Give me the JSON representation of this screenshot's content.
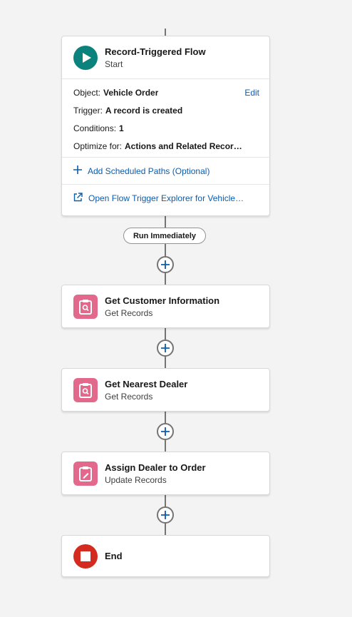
{
  "start": {
    "title": "Record-Triggered Flow",
    "subtitle": "Start",
    "object_label": "Object:",
    "object_value": "Vehicle Order",
    "edit_label": "Edit",
    "trigger_label": "Trigger:",
    "trigger_value": "A record is created",
    "conditions_label": "Conditions:",
    "conditions_value": "1",
    "optimize_label": "Optimize for:",
    "optimize_value": "Actions and Related Recor…",
    "add_paths_label": "Add Scheduled Paths (Optional)",
    "explorer_label": "Open Flow Trigger Explorer for Vehicle…"
  },
  "path_label": "Run Immediately",
  "elements": [
    {
      "title": "Get Customer Information",
      "subtitle": "Get Records",
      "icon": "get-records-icon"
    },
    {
      "title": "Get Nearest Dealer",
      "subtitle": "Get Records",
      "icon": "get-records-icon"
    },
    {
      "title": "Assign Dealer to Order",
      "subtitle": "Update Records",
      "icon": "update-records-icon"
    }
  ],
  "end": {
    "title": "End"
  },
  "colors": {
    "start_icon": "#0b827c",
    "record_icon": "#e3698c",
    "end_icon": "#d32b1f",
    "link": "#0b5cab",
    "connector": "#747474",
    "canvas": "#f3f3f3"
  }
}
